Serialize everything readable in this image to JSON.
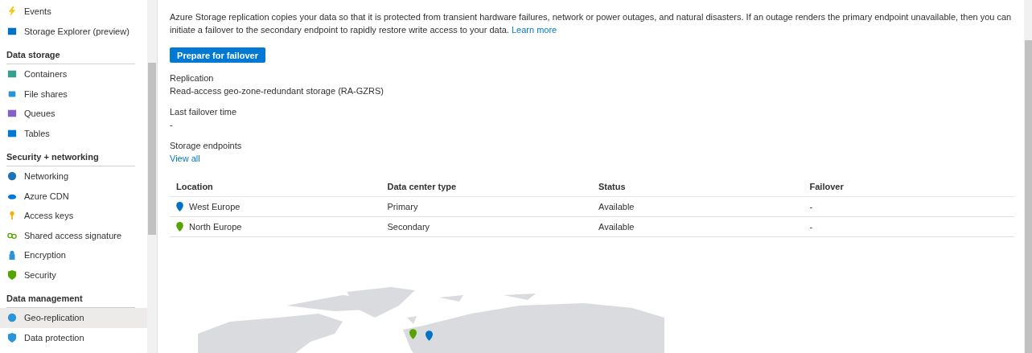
{
  "sidebar": {
    "items": [
      {
        "kind": "item",
        "label": "Events",
        "selected": false
      },
      {
        "kind": "item",
        "label": "Storage Explorer (preview)",
        "selected": false
      },
      {
        "kind": "section",
        "label": "Data storage"
      },
      {
        "kind": "item",
        "label": "Containers",
        "selected": false
      },
      {
        "kind": "item",
        "label": "File shares",
        "selected": false
      },
      {
        "kind": "item",
        "label": "Queues",
        "selected": false
      },
      {
        "kind": "item",
        "label": "Tables",
        "selected": false
      },
      {
        "kind": "section",
        "label": "Security + networking"
      },
      {
        "kind": "item",
        "label": "Networking",
        "selected": false
      },
      {
        "kind": "item",
        "label": "Azure CDN",
        "selected": false
      },
      {
        "kind": "item",
        "label": "Access keys",
        "selected": false
      },
      {
        "kind": "item",
        "label": "Shared access signature",
        "selected": false
      },
      {
        "kind": "item",
        "label": "Encryption",
        "selected": false
      },
      {
        "kind": "item",
        "label": "Security",
        "selected": false
      },
      {
        "kind": "section",
        "label": "Data management"
      },
      {
        "kind": "item",
        "label": "Geo-replication",
        "selected": true
      },
      {
        "kind": "item",
        "label": "Data protection",
        "selected": false
      }
    ]
  },
  "description": "Azure Storage replication copies your data so that it is protected from transient hardware failures, network or power outages, and natural disasters. If an outage renders the primary endpoint unavailable, then you can initiate a failover to the secondary endpoint to rapidly restore write access to your data.",
  "learn_more": "Learn more",
  "primary_button": "Prepare for failover",
  "fields": [
    {
      "label": "Replication",
      "value": "Read-access geo-zone-redundant storage (RA-GZRS)"
    },
    {
      "label": "Last failover time",
      "value": "-"
    }
  ],
  "endpoints": {
    "label": "Storage endpoints",
    "link": "View all"
  },
  "table": {
    "columns": [
      "Location",
      "Data center type",
      "Status",
      "Failover"
    ],
    "rows": [
      {
        "location": "West Europe",
        "color": "#0072c6",
        "type": "Primary",
        "status": "Available",
        "failover": "-"
      },
      {
        "location": "North Europe",
        "color": "#57a300",
        "type": "Secondary",
        "status": "Available",
        "failover": "-"
      }
    ]
  }
}
